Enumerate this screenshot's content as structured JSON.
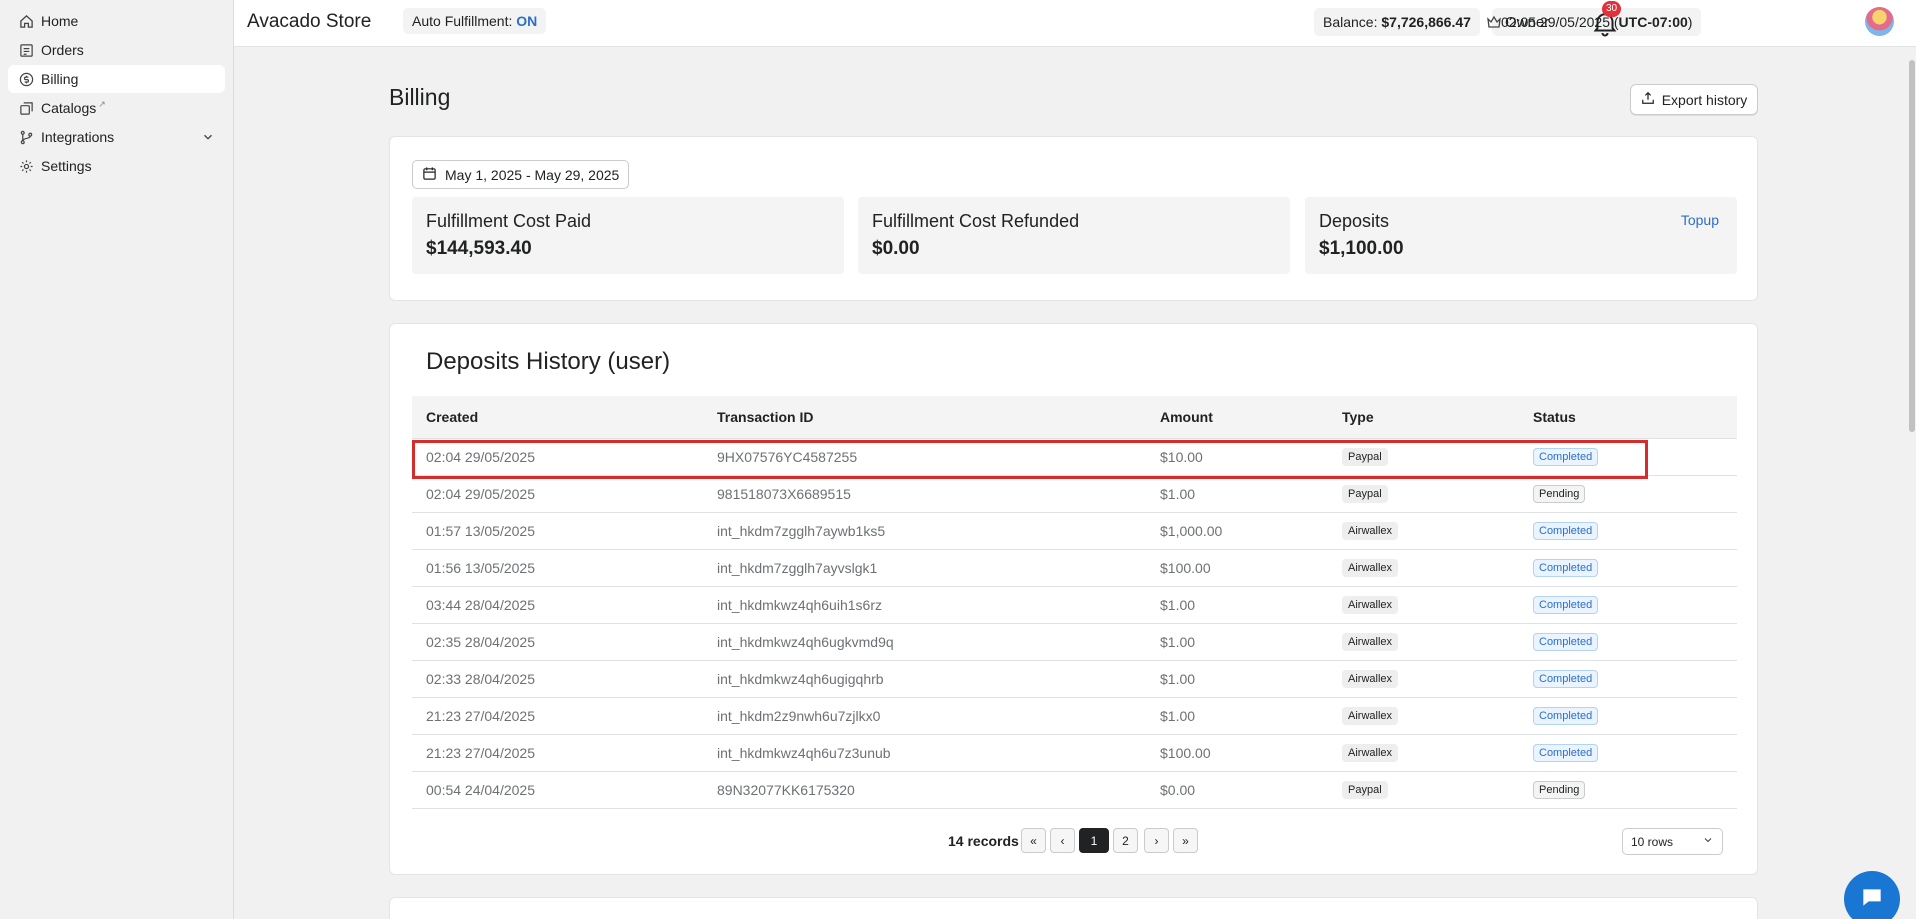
{
  "sidebar": {
    "items": [
      {
        "label": "Home",
        "icon": "home-icon"
      },
      {
        "label": "Orders",
        "icon": "orders-icon"
      },
      {
        "label": "Billing",
        "icon": "dollar-icon"
      },
      {
        "label": "Catalogs",
        "icon": "catalog-icon"
      },
      {
        "label": "Integrations",
        "icon": "branch-icon"
      },
      {
        "label": "Settings",
        "icon": "gear-icon"
      }
    ]
  },
  "topbar": {
    "store_name": "Avacado Store",
    "auto_fulfillment_label": "Auto Fulfillment: ",
    "auto_fulfillment_value": "ON",
    "balance_label": "Balance: ",
    "balance_value": "$7,726,866.47",
    "time_value": "02:05 29/05/2025 (",
    "timezone": "UTC-07:00",
    "time_close": ")",
    "owner_label": "Owner",
    "notification_count": "30"
  },
  "main": {
    "title": "Billing",
    "export_label": "Export history",
    "date_range": "May 1, 2025 - May 29, 2025",
    "stats": [
      {
        "label": "Fulfillment Cost Paid",
        "value": "$144,593.40"
      },
      {
        "label": "Fulfillment Cost Refunded",
        "value": "$0.00"
      },
      {
        "label": "Deposits",
        "value": "$1,100.00",
        "action": "Topup"
      }
    ]
  },
  "deposits": {
    "title": "Deposits History (user)",
    "columns": [
      "Created",
      "Transaction ID",
      "Amount",
      "Type",
      "Status"
    ],
    "rows": [
      {
        "created": "02:04 29/05/2025",
        "txid": "9HX07576YC4587255",
        "amount": "$10.00",
        "type": "Paypal",
        "status": "Completed"
      },
      {
        "created": "02:04 29/05/2025",
        "txid": "981518073X6689515",
        "amount": "$1.00",
        "type": "Paypal",
        "status": "Pending"
      },
      {
        "created": "01:57 13/05/2025",
        "txid": "int_hkdm7zgglh7aywb1ks5",
        "amount": "$1,000.00",
        "type": "Airwallex",
        "status": "Completed"
      },
      {
        "created": "01:56 13/05/2025",
        "txid": "int_hkdm7zgglh7ayvslgk1",
        "amount": "$100.00",
        "type": "Airwallex",
        "status": "Completed"
      },
      {
        "created": "03:44 28/04/2025",
        "txid": "int_hkdmkwz4qh6uih1s6rz",
        "amount": "$1.00",
        "type": "Airwallex",
        "status": "Completed"
      },
      {
        "created": "02:35 28/04/2025",
        "txid": "int_hkdmkwz4qh6ugkvmd9q",
        "amount": "$1.00",
        "type": "Airwallex",
        "status": "Completed"
      },
      {
        "created": "02:33 28/04/2025",
        "txid": "int_hkdmkwz4qh6ugigqhrb",
        "amount": "$1.00",
        "type": "Airwallex",
        "status": "Completed"
      },
      {
        "created": "21:23 27/04/2025",
        "txid": "int_hkdm2z9nwh6u7zjlkx0",
        "amount": "$1.00",
        "type": "Airwallex",
        "status": "Completed"
      },
      {
        "created": "21:23 27/04/2025",
        "txid": "int_hkdmkwz4qh6u7z3unub",
        "amount": "$100.00",
        "type": "Airwallex",
        "status": "Completed"
      },
      {
        "created": "00:54 24/04/2025",
        "txid": "89N32077KK6175320",
        "amount": "$0.00",
        "type": "Paypal",
        "status": "Pending"
      }
    ],
    "records": "14 records",
    "pages": [
      "1",
      "2"
    ],
    "rows_per_page": "10 rows"
  }
}
